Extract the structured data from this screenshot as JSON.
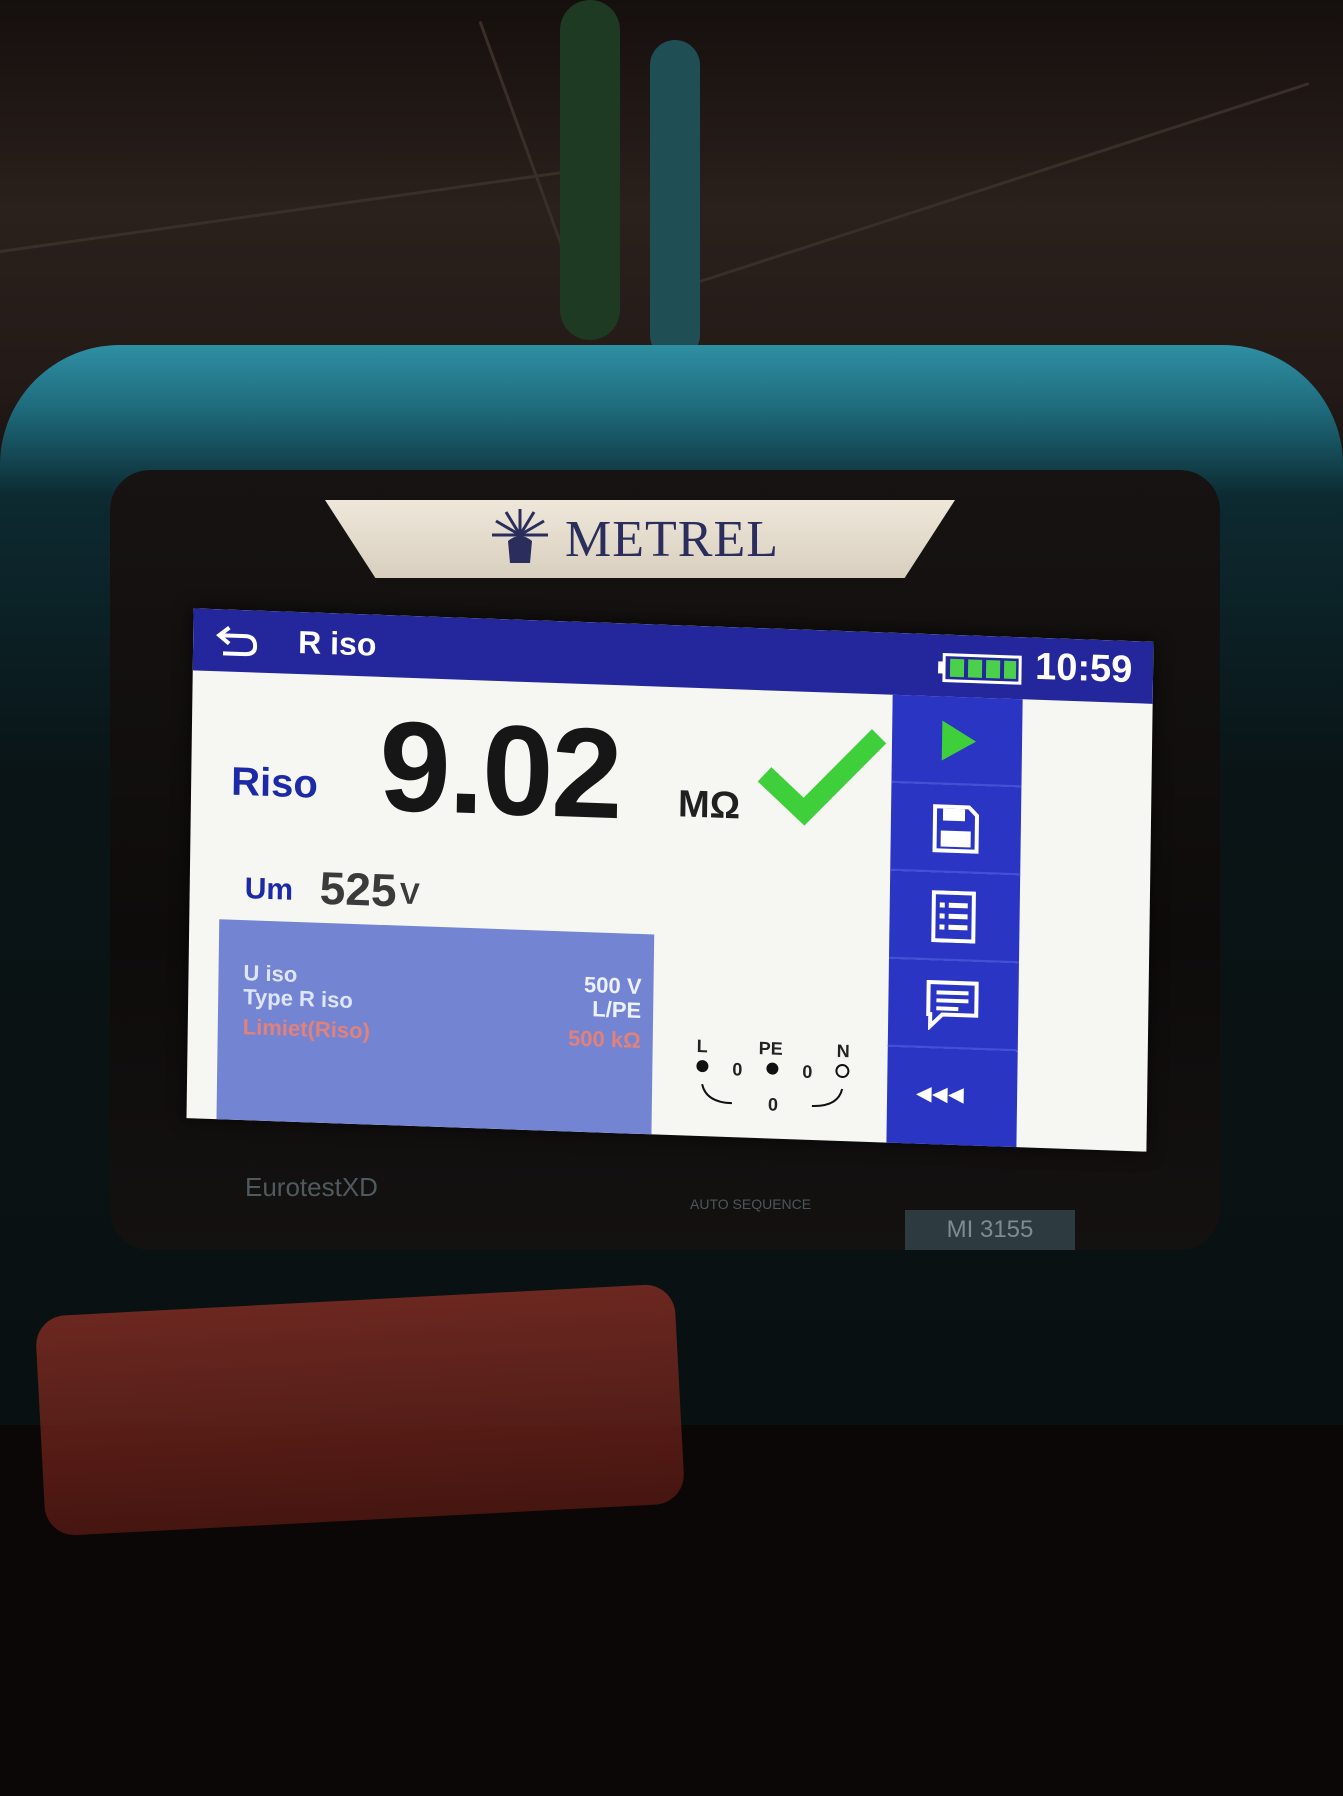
{
  "brand": {
    "name": "METREL"
  },
  "device": {
    "model_line": "EurotestXD",
    "model_number": "MI 3155",
    "auto_sequence": "AUTO SEQUENCE"
  },
  "header": {
    "title": "R iso",
    "time": "10:59",
    "back_icon": "back-arrow-icon",
    "battery_icon": "battery-full-icon"
  },
  "result": {
    "name": "Riso",
    "value": "9.02",
    "unit": "MΩ",
    "status_icon": "check-icon",
    "status_color": "#3fcf3a"
  },
  "measured": {
    "label": "Um",
    "value": "525",
    "unit": "V"
  },
  "parameters": [
    {
      "label": "U iso",
      "value": "500 V"
    },
    {
      "label": "Type R iso",
      "value": "L/PE"
    },
    {
      "label": "Limiet(Riso)",
      "value": "500 kΩ"
    }
  ],
  "terminals": {
    "L": "L",
    "PE": "PE",
    "N": "N",
    "l_pe": "0",
    "pe_n": "0",
    "l_n": "0"
  },
  "sidebar": [
    {
      "icon": "play-icon"
    },
    {
      "icon": "save-icon"
    },
    {
      "icon": "list-icon"
    },
    {
      "icon": "comment-icon"
    },
    {
      "icon": "collapse-icon",
      "label": "◂◂◂"
    }
  ],
  "colors": {
    "titlebar": "#23279b",
    "sidebar": "#2b35c4",
    "params_panel": "#7385d2",
    "label_blue": "#1d2aa8",
    "limit_red": "#e2807a"
  }
}
